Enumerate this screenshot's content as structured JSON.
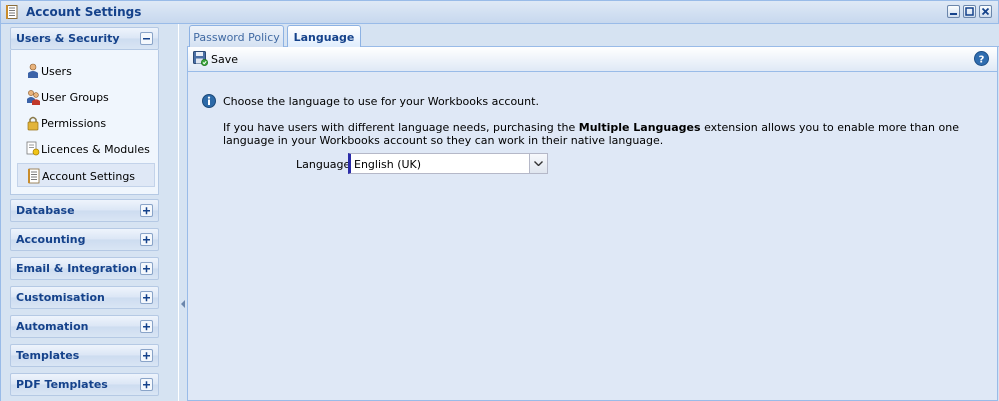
{
  "window": {
    "title": "Account Settings"
  },
  "sidebar": {
    "open_group": {
      "title": "Users & Security",
      "items": [
        {
          "label": "Users",
          "icon": "user-icon"
        },
        {
          "label": "User Groups",
          "icon": "user-group-icon"
        },
        {
          "label": "Permissions",
          "icon": "lock-icon"
        },
        {
          "label": "Licences & Modules",
          "icon": "licence-icon"
        },
        {
          "label": "Account Settings",
          "icon": "settings-document-icon",
          "selected": true
        }
      ]
    },
    "groups": [
      {
        "title": "Database"
      },
      {
        "title": "Accounting"
      },
      {
        "title": "Email & Integration"
      },
      {
        "title": "Customisation"
      },
      {
        "title": "Automation"
      },
      {
        "title": "Templates"
      },
      {
        "title": "PDF Templates"
      }
    ]
  },
  "tabs": [
    {
      "label": "Password Policy"
    },
    {
      "label": "Language",
      "active": true
    }
  ],
  "toolbar": {
    "save_label": "Save"
  },
  "content": {
    "info": "Choose the language to use for your Workbooks account.",
    "para_before": "If you have users with different language needs, purchasing the ",
    "para_bold": "Multiple Languages",
    "para_after": " extension allows you to enable more than one language in your Workbooks account so they can work in their native language.",
    "language_label": "Language",
    "language_value": "English (UK)"
  },
  "colors": {
    "header_text": "#15428b",
    "panel_bg": "#dfe8f6",
    "border": "#99bbe8",
    "select_accent": "#2a2ba8"
  }
}
